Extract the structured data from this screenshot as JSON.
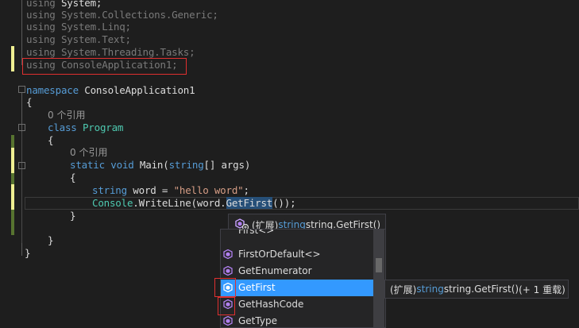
{
  "code": {
    "usings": [
      {
        "kw": "using",
        "rest": " System;"
      },
      {
        "kw": "using",
        "rest": " System.Collections.Generic;"
      },
      {
        "kw": "using",
        "rest": " System.Linq;"
      },
      {
        "kw": "using",
        "rest": " System.Text;"
      },
      {
        "kw": "using",
        "rest": " System.Threading.Tasks;"
      },
      {
        "kw": "using",
        "rest": " ConsoleApplication1;"
      }
    ],
    "namespace_kw": "namespace",
    "namespace_name": " ConsoleApplication1",
    "open_brace": "{",
    "close_brace": "}",
    "ref_count_label": "0 个引用",
    "class_kw": "class",
    "class_name": "Program",
    "static_kw": "static",
    "void_kw": "void",
    "main_sig": " Main(",
    "string_kw": "string",
    "args": "[] args)",
    "string_decl_kw": "string",
    "var_decl": " word = ",
    "string_literal": "\"hello word\"",
    "semicolon": ";",
    "console_type": "Console",
    "writeline_pre": ".WriteLine(word.",
    "method_selected": "GetFirst",
    "writeline_post": "());"
  },
  "quickinfo_top": {
    "prefix": "(扩展) ",
    "type_kw": "string",
    "signature": " string.GetFirst()"
  },
  "quickinfo_side": {
    "prefix": "(扩展) ",
    "type_kw": "string",
    "signature": " string.GetFirst()",
    "overloads": " (+ 1 重载)"
  },
  "completion": {
    "items": [
      {
        "label": "First<>",
        "icon": "extension-method-icon"
      },
      {
        "label": "FirstOrDefault<>",
        "icon": "extension-method-icon"
      },
      {
        "label": "GetEnumerator",
        "icon": "method-icon"
      },
      {
        "label": "GetFirst",
        "icon": "extension-method-icon",
        "selected": true
      },
      {
        "label": "GetHashCode",
        "icon": "method-icon"
      },
      {
        "label": "GetType",
        "icon": "method-icon"
      }
    ],
    "selected_index": 3
  },
  "colors": {
    "background": "#1e1e1e",
    "keyword": "#569cd6",
    "type": "#4ec9b0",
    "string": "#d69d85",
    "selection": "#3399ff",
    "change_bar_yellow": "#efef91",
    "change_bar_green": "#577430",
    "highlight_box": "#e03030"
  }
}
